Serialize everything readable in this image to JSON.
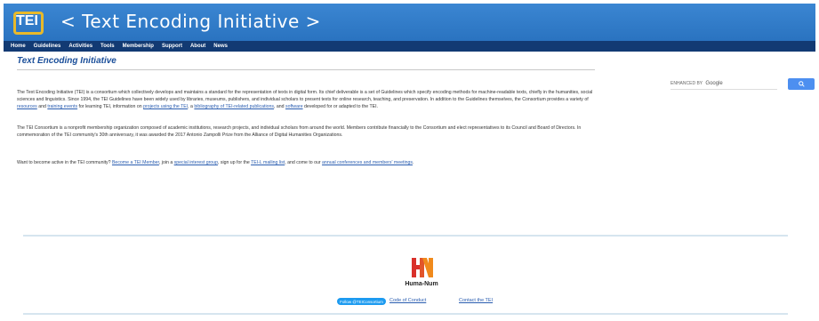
{
  "header": {
    "logo_text": "TEI",
    "title": "< Text Encoding Initiative >"
  },
  "nav": {
    "items": [
      "Home",
      "Guidelines",
      "Activities",
      "Tools",
      "Membership",
      "Support",
      "About",
      "News"
    ]
  },
  "main": {
    "title": "Text Encoding Initiative",
    "p1": {
      "t1": "The Text Encoding Initiative (TEI) is a consortium which collectively develops and maintains a standard for the representation of texts in digital form. Its chief deliverable is a set of Guidelines which specify encoding methods for machine-readable texts, chiefly in the humanities, social sciences and linguistics. Since 1994, the TEI Guidelines have been widely used by libraries, museums, publishers, and individual scholars to present texts for online research, teaching, and preservation. In addition to the Guidelines themselves, the Consortium provides a variety of ",
      "link1": "resources",
      "t2": " and ",
      "link2": "training events",
      "t3": " for learning TEI, information on ",
      "link3": "projects using the TEI",
      "t4": ", a ",
      "link4": "bibliography of TEI-related publications",
      "t5": ", and ",
      "link5": "software",
      "t6": " developed for or adapted to the TEI."
    },
    "p2": "The TEI Consortium is a nonprofit membership organization composed of academic institutions, research projects, and individual scholars from around the world. Members contribute financially to the Consortium and elect representatives to its Council and Board of Directors. In commemoration of the TEI community's 30th anniversary, it was awarded the 2017 Antonio Zampolli Prize from the Alliance of Digital Humanities Organizations.",
    "p3": {
      "t1": "Want to become active in the TEI community? ",
      "link1": "Become a TEI Member",
      "t2": ", join a ",
      "link2": "special interest group",
      "t3": ", sign up for the ",
      "link3": "TEI-L mailing list",
      "t4": ", and come to our ",
      "link4": "annual conferences and members' meetings",
      "t5": "."
    }
  },
  "search": {
    "prefix": "ENHANCED BY",
    "brand": "Google"
  },
  "footer": {
    "partner_name": "Huma-Num",
    "follow_label": "Follow @TEIConsortium",
    "code_of_conduct": "Code of Conduct",
    "contact": "Contact the TEI"
  },
  "colors": {
    "banner": "#2b78c6",
    "nav": "#123a73",
    "title": "#1b4f9a",
    "link": "#2a5db0",
    "search_button": "#4d8ff0",
    "huma_red": "#d9302b",
    "huma_orange": "#f08a1c"
  }
}
